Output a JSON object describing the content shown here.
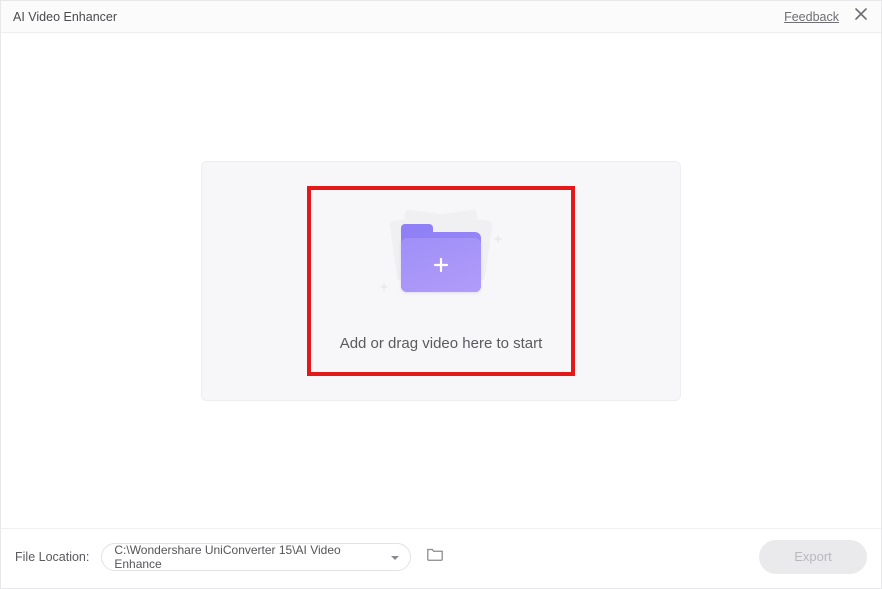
{
  "titlebar": {
    "title": "AI Video Enhancer",
    "feedback_label": "Feedback"
  },
  "dropzone": {
    "prompt": "Add or drag video here to start"
  },
  "bottombar": {
    "file_location_label": "File Location:",
    "file_location_path": "C:\\Wondershare UniConverter 15\\AI Video Enhance",
    "export_label": "Export"
  }
}
